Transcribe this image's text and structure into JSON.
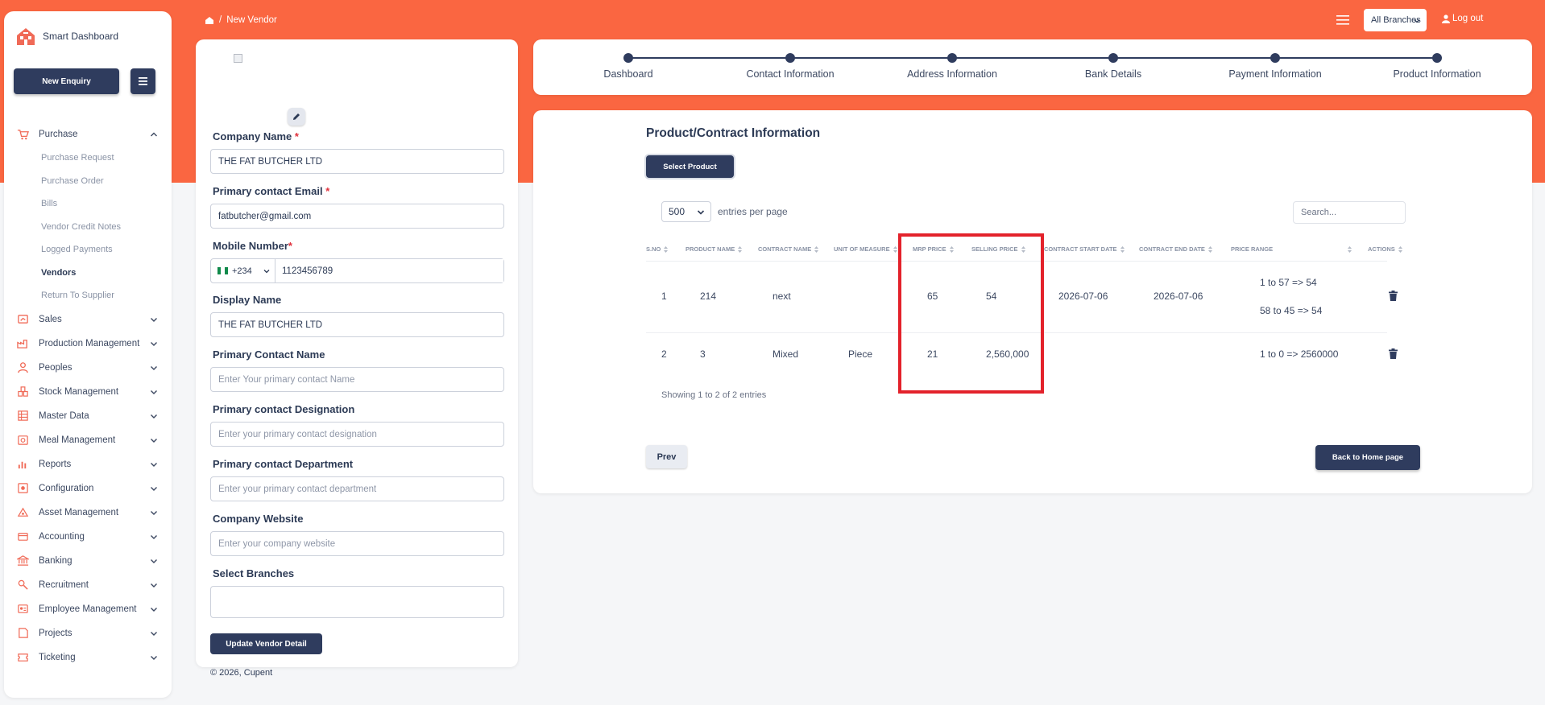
{
  "brand": {
    "name": "Smart Dashboard"
  },
  "sidebar": {
    "new_enquiry": "New Enquiry",
    "purchase": {
      "label": "Purchase",
      "children": [
        "Purchase Request",
        "Purchase Order",
        "Bills",
        "Vendor Credit Notes",
        "Logged Payments",
        "Vendors",
        "Return To Supplier"
      ],
      "active": "Vendors"
    },
    "items": [
      "Sales",
      "Production Management",
      "Peoples",
      "Stock Management",
      "Master Data",
      "Meal Management",
      "Reports",
      "Configuration",
      "Asset Management",
      "Accounting",
      "Banking",
      "Recruitment",
      "Employee Management",
      "Projects",
      "Ticketing"
    ]
  },
  "topbar": {
    "breadcrumb_separator": "/",
    "breadcrumb": "New Vendor",
    "branch": "All Branches",
    "logout": "Log out"
  },
  "form": {
    "company_name": {
      "label": "Company Name",
      "value": "THE FAT BUTCHER LTD"
    },
    "email": {
      "label": "Primary contact Email",
      "value": "fatbutcher@gmail.com"
    },
    "mobile": {
      "label": "Mobile Number",
      "dial_code": "+234",
      "value": "1123456789"
    },
    "display_name": {
      "label": "Display Name",
      "value": "THE FAT BUTCHER LTD"
    },
    "contact_name": {
      "label": "Primary Contact Name",
      "placeholder": "Enter Your primary contact Name"
    },
    "designation": {
      "label": "Primary contact Designation",
      "placeholder": "Enter your primary contact designation"
    },
    "department": {
      "label": "Primary contact Department",
      "placeholder": "Enter your primary contact department"
    },
    "website": {
      "label": "Company Website",
      "placeholder": "Enter your company website"
    },
    "branches": {
      "label": "Select Branches"
    },
    "required_mark": "*",
    "update_button": "Update Vendor Detail"
  },
  "footer": {
    "text": "© 2026, ",
    "company": "Cupent"
  },
  "stepper": {
    "steps": [
      "Dashboard",
      "Contact Information",
      "Address Information",
      "Bank Details",
      "Payment Information",
      "Product Information"
    ]
  },
  "product": {
    "title": "Product/Contract Information",
    "select_button": "Select Product",
    "entries_value": "500",
    "entries_label": "entries per page",
    "search_placeholder": "Search...",
    "headers": [
      "S.NO",
      "PRODUCT NAME",
      "CONTRACT NAME",
      "UNIT OF MEASURE",
      "MRP PRICE",
      "SELLING PRICE",
      "CONTRACT START DATE",
      "CONTRACT END DATE",
      "PRICE RANGE",
      "ACTIONS"
    ],
    "rows": [
      {
        "sno": "1",
        "product": "214",
        "contract": "next",
        "unit": "",
        "mrp": "65",
        "selling": "54",
        "start": "2026-07-06",
        "end": "2026-07-06",
        "ranges": [
          "1 to 57 => 54",
          "58 to 45 => 54"
        ]
      },
      {
        "sno": "2",
        "product": "3",
        "contract": "Mixed",
        "unit": "Piece",
        "mrp": "21",
        "selling": "2,560,000",
        "start": "",
        "end": "",
        "ranges": [
          "1 to 0 => 2560000"
        ]
      }
    ],
    "showing": "Showing 1 to 2 of 2 entries",
    "prev_button": "Prev",
    "home_button": "Back to Home page"
  },
  "colors": {
    "brand_orange": "#fa6641",
    "navy": "#2f3c5e",
    "highlight_red": "#e3222b",
    "required_red": "#e0313c"
  }
}
